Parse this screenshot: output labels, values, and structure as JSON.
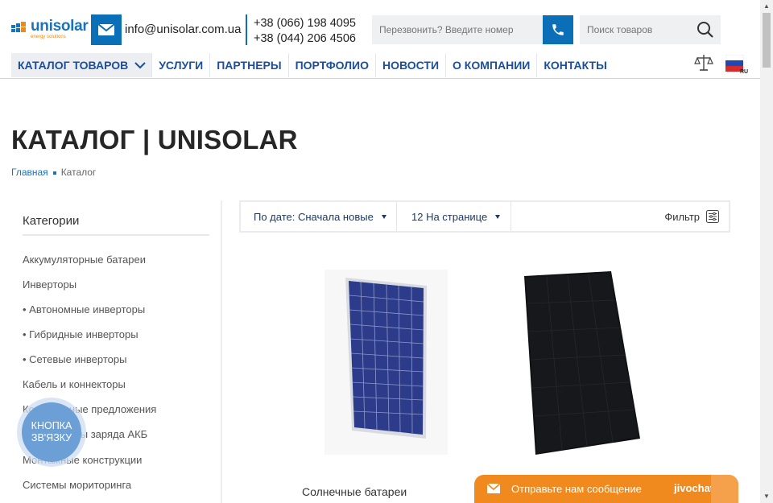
{
  "header": {
    "logo_text": "unisolar",
    "logo_tagline": "energy solutions",
    "email": "info@unisolar.com.ua",
    "phone_1": "+38 (066) 198 4095",
    "phone_2": "+38 (044) 206 4506",
    "callback_placeholder": "Перезвонить? Введите номер",
    "search_placeholder": "Поиск товаров",
    "language": "RU"
  },
  "nav": {
    "items": [
      {
        "label": "КАТАЛОГ ТОВАРОВ"
      },
      {
        "label": "УСЛУГИ"
      },
      {
        "label": "ПАРТНЕРЫ"
      },
      {
        "label": "ПОРТФОЛИО"
      },
      {
        "label": "НОВОСТИ"
      },
      {
        "label": "О КОМПАНИИ"
      },
      {
        "label": "КОНТАКТЫ"
      }
    ]
  },
  "page": {
    "title": "КАТАЛОГ | UNISOLAR",
    "breadcrumb": [
      "Главная",
      "Каталог"
    ]
  },
  "sidebar": {
    "heading": "Категории",
    "categories": [
      "Аккумуляторные батареи",
      "Инверторы",
      "• Автономные инверторы",
      "• Гибридные инверторы",
      "• Сетевые инверторы",
      "Кабель и коннекторы",
      "Комплексные предложения",
      "Контроллеры заряда АКБ",
      "Монтажные конструкции",
      "Системы мориторинга"
    ]
  },
  "toolbar": {
    "sort_label": "По дате: Сначала новые",
    "per_page_label": "12 На странице",
    "filter_label": "Фильтр"
  },
  "products": [
    {
      "title": "Солнечные батареи",
      "subtitle": "…"
    },
    {
      "title": "",
      "subtitle": ""
    }
  ],
  "widgets": {
    "contact_button_line1": "КНОПКА",
    "contact_button_line2": "ЗВ'ЯЗКУ",
    "chat_message": "Отправьте нам сообщение",
    "chat_brand": "jivochat"
  },
  "colors": {
    "brand_blue": "#0a6fb6",
    "nav_blue": "#1b4f9c",
    "chat_orange": "#f0891e"
  }
}
